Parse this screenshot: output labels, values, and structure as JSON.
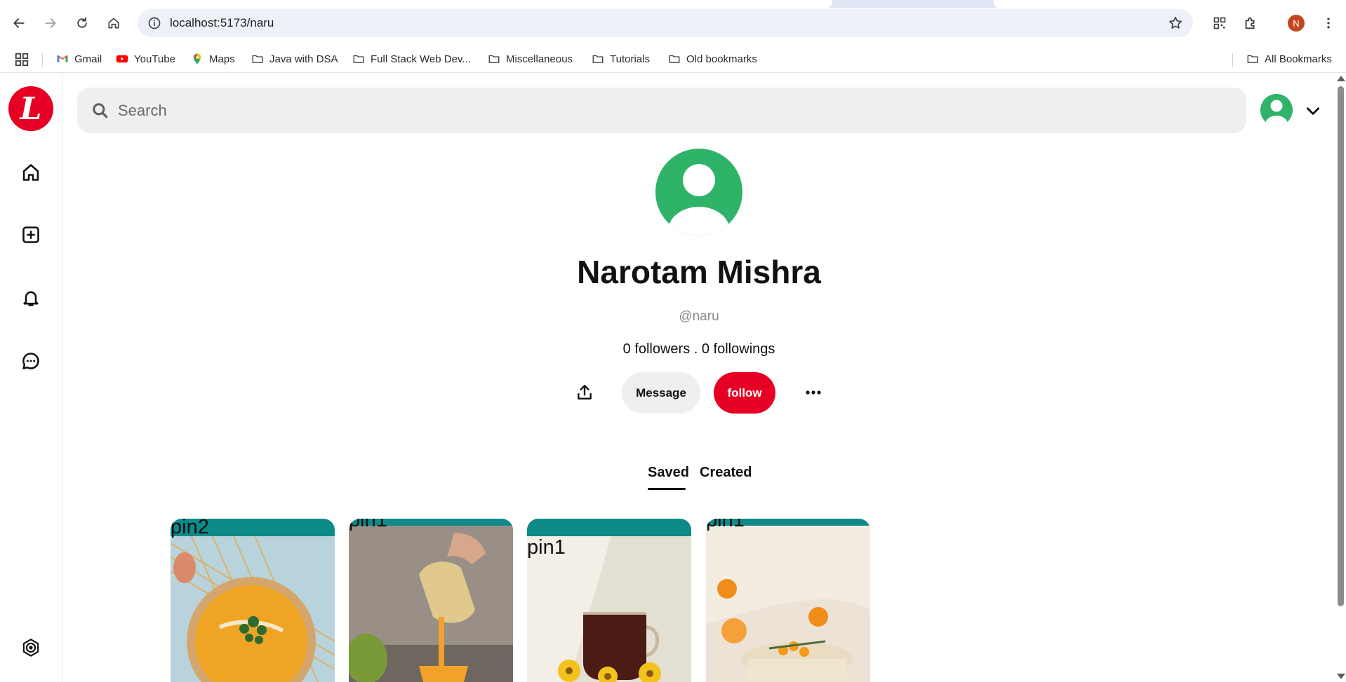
{
  "browser": {
    "url": "localhost:5173/naru",
    "profile_initial": "N",
    "bookmarks": [
      {
        "label": "Gmail"
      },
      {
        "label": "YouTube"
      },
      {
        "label": "Maps"
      },
      {
        "label": "Java with DSA"
      },
      {
        "label": "Full Stack Web Dev..."
      },
      {
        "label": "Miscellaneous"
      },
      {
        "label": "Tutorials"
      },
      {
        "label": "Old bookmarks"
      }
    ],
    "all_bookmarks_label": "All Bookmarks"
  },
  "app": {
    "logo_letter": "L",
    "brand_color": "#e60023",
    "search": {
      "placeholder": "Search"
    },
    "sidebar_icons": [
      "home-icon",
      "create-icon",
      "notifications-icon",
      "messages-icon",
      "settings-icon"
    ]
  },
  "profile": {
    "name": "Narotam Mishra",
    "handle": "@naru",
    "stats": "0 followers . 0 followings",
    "message_label": "Message",
    "follow_label": "follow"
  },
  "tabs": [
    {
      "label": "Saved",
      "active": true
    },
    {
      "label": "Created",
      "active": false
    }
  ],
  "pins": [
    {
      "label": "pin2",
      "subject": "soup-bowl"
    },
    {
      "label": "pin1",
      "subject": "pouring-juice"
    },
    {
      "label": "pin1",
      "subject": "tea-cup"
    },
    {
      "label": "pin1",
      "subject": "cake-oranges"
    }
  ]
}
